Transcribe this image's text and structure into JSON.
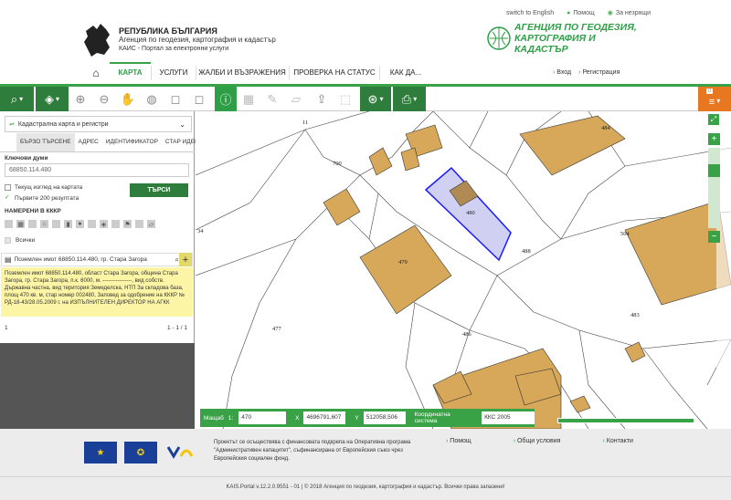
{
  "top_links": {
    "english": "switch to English",
    "help": "Помощ",
    "favorites": "За незрящи"
  },
  "header": {
    "line1": "РЕПУБЛИКА БЪЛГАРИЯ",
    "line2": "Агенция по геодезия, картография и кадастър",
    "line3": "КАИС - Портал за електронни услуги",
    "agency_line1": "АГЕНЦИЯ ПО ГЕОДЕЗИЯ,",
    "agency_line2": "КАРТОГРАФИЯ И КАДАСТЪР"
  },
  "nav": {
    "items": [
      "КАРТА",
      "УСЛУГИ",
      "ЖАЛБИ И ВЪЗРАЖЕНИЯ",
      "ПРОВЕРКА НА СТАТУС",
      "КАК ДА..."
    ],
    "login": "Вход",
    "register": "Регистрация"
  },
  "toolbar": {
    "badge": "0"
  },
  "panel": {
    "layer": "Кадастрална карта и регистри",
    "tabs": [
      "БЪРЗО ТЪРСЕНЕ",
      "АДРЕС",
      "ИДЕНТИФИКАТОР",
      "СТАР ИДЕН"
    ],
    "keywords_label": "Ключови думи",
    "keywords_value": "68850.114.480",
    "current_view": "Текущ изглед на картата",
    "first200": "Първите 200 резултата",
    "search_button": "ТЪРСИ",
    "found_label": "НАМЕРЕНИ В КККР",
    "all": "Всички",
    "result_title": "Поземлен имот 68850.114.480, гр. Стара Загора",
    "result_text_1": "Поземлен имот 68850.114.480, област Стара Загора, община Стара Загора, гр. Стара Загора, п.к. 6000, м. ----------------, вид собств. Държавна частна, вид територия Земеделска, НТП За складова база, площ 470 кв. м, стар номер 002480,",
    "result_text_2": "Заповед за одобрение на КККР № РД-18-43/28.05.2009 г. на ИЗПЪЛНИТЕЛЕН ДИРЕКТОР НА АГКК",
    "page": "1",
    "page_range": "1 - 1 / 1"
  },
  "map": {
    "labels": {
      "p11": "11",
      "p700": "700",
      "p480": "480",
      "p488": "488",
      "p504": "504",
      "p483": "483",
      "p486": "486",
      "p477": "477",
      "p479": "479",
      "p484": "484",
      "p34": "34"
    }
  },
  "coords": {
    "scale_label": "Мащаб",
    "scale_prefix": "1:",
    "scale_value": "470",
    "x_label": "X",
    "x_value": "4696791,607",
    "y_label": "Y",
    "y_value": "512058,506",
    "cs_label": "Координатна система",
    "cs_value": "ККС 2005"
  },
  "footer": {
    "text": "Проектът се осъществява с финансовата подкрепа на Оперативна програма \"Административен капацитет\", съфинансирана от Европейския съюз чрез Европейския социален фонд.",
    "links": [
      "Помощ",
      "Общи условия",
      "Контакти"
    ],
    "copyright": "KAIS.Portal v.12.2.0.9551 - 01  |  © 2018 Агенция по геодезия, картография и кадастър. Всички права запазени!"
  }
}
